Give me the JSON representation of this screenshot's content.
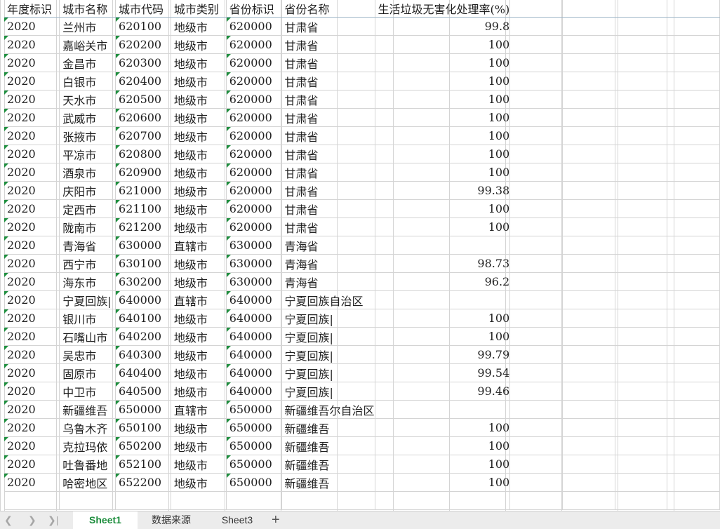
{
  "sheet": {
    "headers": [
      "年度标识",
      "城市名称",
      "城市代码",
      "城市类别",
      "省份标识",
      "省份名称",
      "生活垃圾无害化处理率(%)"
    ],
    "rows": [
      [
        "2020",
        "兰州市",
        "620100",
        "地级市",
        "620000",
        "甘肃省",
        "99.8"
      ],
      [
        "2020",
        "嘉峪关市",
        "620200",
        "地级市",
        "620000",
        "甘肃省",
        "100"
      ],
      [
        "2020",
        "金昌市",
        "620300",
        "地级市",
        "620000",
        "甘肃省",
        "100"
      ],
      [
        "2020",
        "白银市",
        "620400",
        "地级市",
        "620000",
        "甘肃省",
        "100"
      ],
      [
        "2020",
        "天水市",
        "620500",
        "地级市",
        "620000",
        "甘肃省",
        "100"
      ],
      [
        "2020",
        "武威市",
        "620600",
        "地级市",
        "620000",
        "甘肃省",
        "100"
      ],
      [
        "2020",
        "张掖市",
        "620700",
        "地级市",
        "620000",
        "甘肃省",
        "100"
      ],
      [
        "2020",
        "平凉市",
        "620800",
        "地级市",
        "620000",
        "甘肃省",
        "100"
      ],
      [
        "2020",
        "酒泉市",
        "620900",
        "地级市",
        "620000",
        "甘肃省",
        "100"
      ],
      [
        "2020",
        "庆阳市",
        "621000",
        "地级市",
        "620000",
        "甘肃省",
        "99.38"
      ],
      [
        "2020",
        "定西市",
        "621100",
        "地级市",
        "620000",
        "甘肃省",
        "100"
      ],
      [
        "2020",
        "陇南市",
        "621200",
        "地级市",
        "620000",
        "甘肃省",
        "100"
      ],
      [
        "2020",
        "青海省",
        "630000",
        "直辖市",
        "630000",
        "青海省",
        ""
      ],
      [
        "2020",
        "西宁市",
        "630100",
        "地级市",
        "630000",
        "青海省",
        "98.73"
      ],
      [
        "2020",
        "海东市",
        "630200",
        "地级市",
        "630000",
        "青海省",
        "96.2"
      ],
      [
        "2020",
        "宁夏回族|",
        "640000",
        "直辖市",
        "640000",
        "宁夏回族自治区",
        ""
      ],
      [
        "2020",
        "银川市",
        "640100",
        "地级市",
        "640000",
        "宁夏回族|",
        "100"
      ],
      [
        "2020",
        "石嘴山市",
        "640200",
        "地级市",
        "640000",
        "宁夏回族|",
        "100"
      ],
      [
        "2020",
        "吴忠市",
        "640300",
        "地级市",
        "640000",
        "宁夏回族|",
        "99.79"
      ],
      [
        "2020",
        "固原市",
        "640400",
        "地级市",
        "640000",
        "宁夏回族|",
        "99.54"
      ],
      [
        "2020",
        "中卫市",
        "640500",
        "地级市",
        "640000",
        "宁夏回族|",
        "99.46"
      ],
      [
        "2020",
        "新疆维吾",
        "650000",
        "直辖市",
        "650000",
        "新疆维吾尔自治区",
        ""
      ],
      [
        "2020",
        "乌鲁木齐",
        "650100",
        "地级市",
        "650000",
        "新疆维吾",
        "100"
      ],
      [
        "2020",
        "克拉玛依",
        "650200",
        "地级市",
        "650000",
        "新疆维吾",
        "100"
      ],
      [
        "2020",
        "吐鲁番地",
        "652100",
        "地级市",
        "650000",
        "新疆维吾",
        "100"
      ],
      [
        "2020",
        "哈密地区",
        "652200",
        "地级市",
        "650000",
        "新疆维吾",
        "100"
      ]
    ]
  },
  "tabs": [
    "Sheet1",
    "数据来源",
    "Sheet3"
  ],
  "active_tab": "Sheet1",
  "add_tab_label": "+",
  "nav": {
    "first": "|<",
    "prev": "<",
    "next": ">",
    "last": ">|"
  },
  "colors": {
    "active_tab": "#1e8e3e",
    "grid": "#d4d4d4",
    "flag": "#1e8e3e"
  }
}
